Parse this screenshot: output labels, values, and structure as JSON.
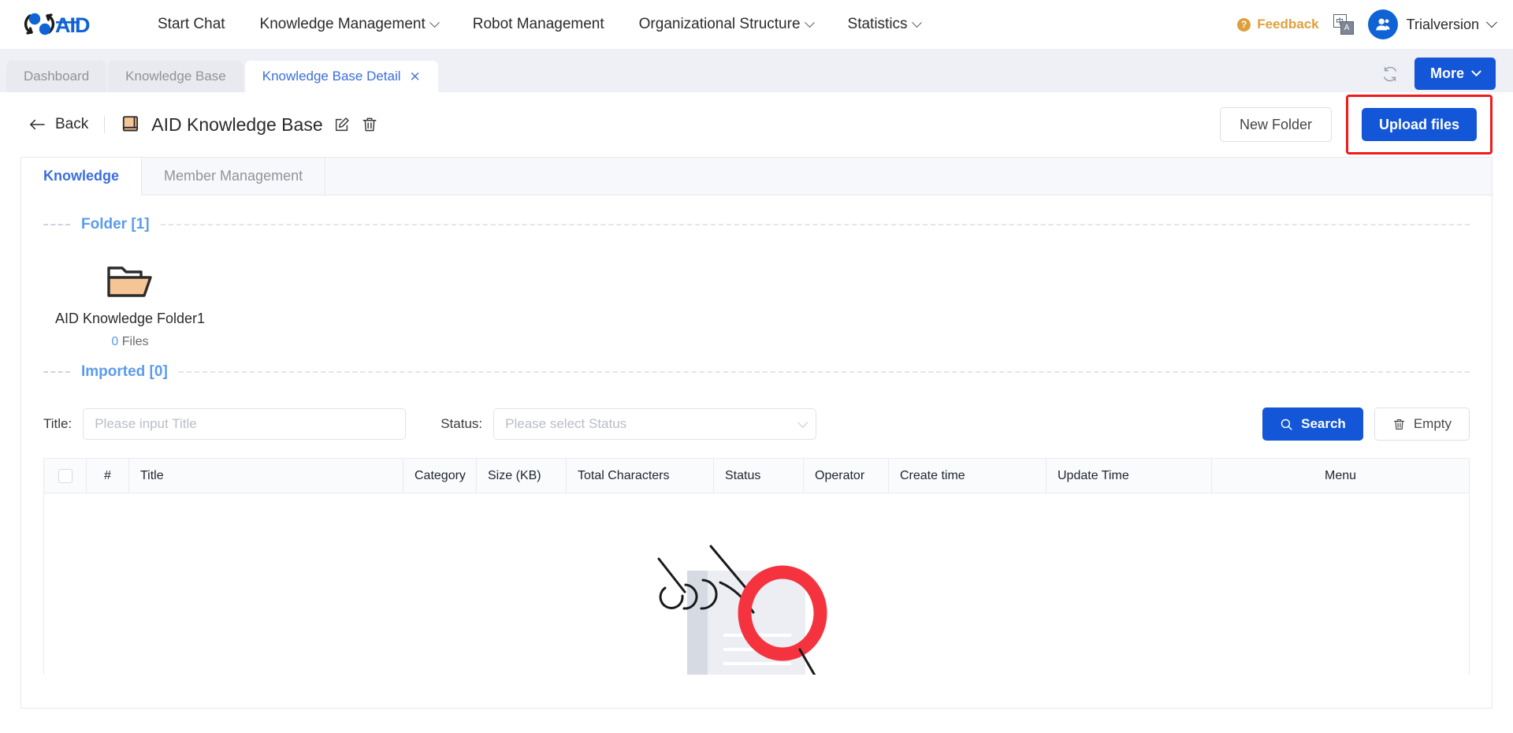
{
  "brand": {
    "name": "AID",
    "logo_icon": "aid-logo-icon"
  },
  "topnav": {
    "items": [
      {
        "label": "Start Chat",
        "has_dropdown": false
      },
      {
        "label": "Knowledge Management",
        "has_dropdown": true
      },
      {
        "label": "Robot Management",
        "has_dropdown": false
      },
      {
        "label": "Organizational Structure",
        "has_dropdown": true
      },
      {
        "label": "Statistics",
        "has_dropdown": true
      }
    ],
    "feedback_label": "Feedback",
    "feedback_icon": "question-circle-icon",
    "feedback_color": "#dea03c",
    "language_icon": "language-switch-icon",
    "language_primary": "中",
    "language_secondary": "A",
    "avatar_icon": "user-avatar-icon",
    "user_name": "Trialversion",
    "user_chevron_icon": "chevron-down-icon"
  },
  "tabstrip": {
    "tabs": [
      {
        "label": "Dashboard",
        "active": false,
        "closable": false
      },
      {
        "label": "Knowledge Base",
        "active": false,
        "closable": false
      },
      {
        "label": "Knowledge Base Detail",
        "active": true,
        "closable": true
      }
    ],
    "close_glyph": "✕",
    "refresh_icon": "refresh-icon",
    "more_label": "More",
    "more_chevron_icon": "chevron-down-icon"
  },
  "page_header": {
    "back_icon": "arrow-left-icon",
    "back_label": "Back",
    "kb_icon": "book-icon",
    "kb_title": "AID Knowledge Base",
    "edit_icon": "edit-pencil-icon",
    "delete_icon": "trash-icon",
    "new_folder_label": "New Folder",
    "upload_files_label": "Upload files",
    "highlight_color": "#f01b1b",
    "primary_color": "#1456d8"
  },
  "card": {
    "tabs": [
      {
        "label": "Knowledge",
        "active": true
      },
      {
        "label": "Member Management",
        "active": false
      }
    ],
    "folder_section": {
      "title": "Folder [1]",
      "folders": [
        {
          "name": "AID Knowledge Folder1",
          "count": "0",
          "count_suffix": " Files",
          "icon": "folder-icon"
        }
      ]
    },
    "imported_section": {
      "title": "Imported [0]",
      "filters": {
        "title_label": "Title:",
        "title_placeholder": "Please input Title",
        "title_value": "",
        "status_label": "Status:",
        "status_placeholder": "Please select Status",
        "status_value": "",
        "status_chevron_icon": "chevron-down-icon"
      },
      "actions": {
        "search_label": "Search",
        "search_icon": "search-icon",
        "empty_label": "Empty",
        "empty_icon": "trash-icon"
      },
      "table": {
        "select_all_icon": "checkbox-icon",
        "columns": [
          "#",
          "Title",
          "Category",
          "Size (KB)",
          "Total Characters",
          "Status",
          "Operator",
          "Create time",
          "Update Time",
          "Menu"
        ],
        "rows": [],
        "empty_illustration": "no-data-magnifier-illustration"
      }
    }
  }
}
